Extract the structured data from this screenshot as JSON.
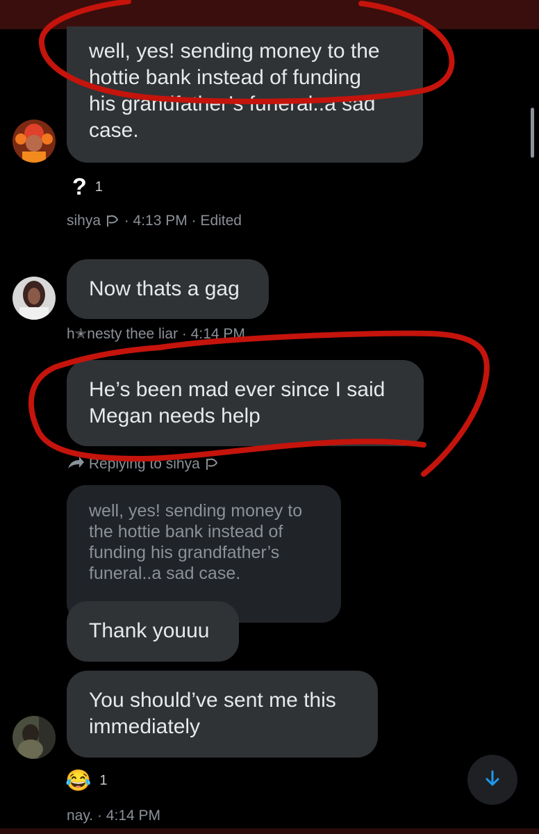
{
  "messages": {
    "m1": {
      "lines": [
        "well, yes! sending money to the",
        "hottie bank instead of funding",
        "his grandfather’s funeral..a sad",
        "case."
      ],
      "reaction": {
        "emoji": "?",
        "count": "1"
      },
      "meta": {
        "author": "sihya",
        "time": "· 4:13 PM",
        "edited": "· Edited"
      }
    },
    "m2": {
      "lines": [
        "Now thats a gag"
      ],
      "meta": {
        "author": "h✭nesty thee liar",
        "time": "· 4:14 PM"
      }
    },
    "m3": {
      "lines": [
        "He’s been mad ever since I said",
        "Megan needs help"
      ],
      "reply_to": "Replying to sihya"
    },
    "quoted": {
      "lines": [
        "well, yes! sending money to",
        "the hottie bank instead of",
        "funding his grandfather’s",
        "funeral..a sad case."
      ]
    },
    "m4": {
      "lines": [
        "Thank youuu"
      ]
    },
    "m5": {
      "lines": [
        "You should’ve sent me this",
        "immediately"
      ],
      "reaction": {
        "emoji": "😂",
        "count": "1"
      },
      "meta": {
        "author": "nay.",
        "time": "· 4:14 PM"
      }
    }
  },
  "colors": {
    "bubble": "#2f3336",
    "quoted_bubble": "#202327",
    "background": "#000000",
    "meta_text": "#8b9198",
    "annotation_red": "#c4140c",
    "accent_blue": "#1d9bf0"
  },
  "icons": {
    "reply_icon": "reply-arrow-icon",
    "scroll_button": "arrow-down-icon",
    "handle_emoji": "hand-emoji-icon"
  }
}
